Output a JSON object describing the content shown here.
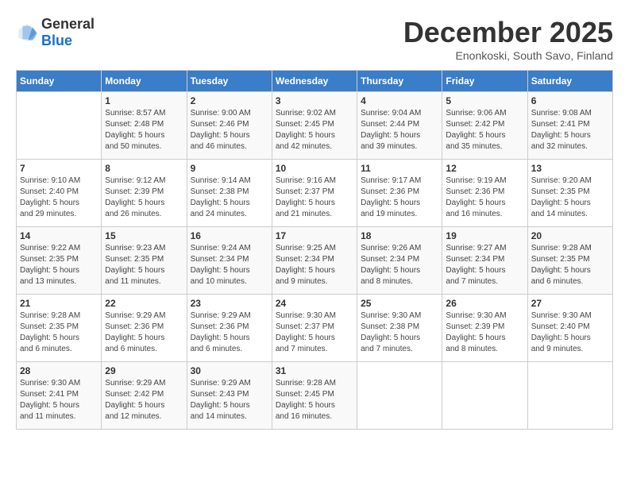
{
  "header": {
    "logo_general": "General",
    "logo_blue": "Blue",
    "month_title": "December 2025",
    "subtitle": "Enonkoski, South Savo, Finland"
  },
  "calendar": {
    "days_of_week": [
      "Sunday",
      "Monday",
      "Tuesday",
      "Wednesday",
      "Thursday",
      "Friday",
      "Saturday"
    ],
    "weeks": [
      [
        {
          "day": "",
          "info": ""
        },
        {
          "day": "1",
          "info": "Sunrise: 8:57 AM\nSunset: 2:48 PM\nDaylight: 5 hours\nand 50 minutes."
        },
        {
          "day": "2",
          "info": "Sunrise: 9:00 AM\nSunset: 2:46 PM\nDaylight: 5 hours\nand 46 minutes."
        },
        {
          "day": "3",
          "info": "Sunrise: 9:02 AM\nSunset: 2:45 PM\nDaylight: 5 hours\nand 42 minutes."
        },
        {
          "day": "4",
          "info": "Sunrise: 9:04 AM\nSunset: 2:44 PM\nDaylight: 5 hours\nand 39 minutes."
        },
        {
          "day": "5",
          "info": "Sunrise: 9:06 AM\nSunset: 2:42 PM\nDaylight: 5 hours\nand 35 minutes."
        },
        {
          "day": "6",
          "info": "Sunrise: 9:08 AM\nSunset: 2:41 PM\nDaylight: 5 hours\nand 32 minutes."
        }
      ],
      [
        {
          "day": "7",
          "info": "Sunrise: 9:10 AM\nSunset: 2:40 PM\nDaylight: 5 hours\nand 29 minutes."
        },
        {
          "day": "8",
          "info": "Sunrise: 9:12 AM\nSunset: 2:39 PM\nDaylight: 5 hours\nand 26 minutes."
        },
        {
          "day": "9",
          "info": "Sunrise: 9:14 AM\nSunset: 2:38 PM\nDaylight: 5 hours\nand 24 minutes."
        },
        {
          "day": "10",
          "info": "Sunrise: 9:16 AM\nSunset: 2:37 PM\nDaylight: 5 hours\nand 21 minutes."
        },
        {
          "day": "11",
          "info": "Sunrise: 9:17 AM\nSunset: 2:36 PM\nDaylight: 5 hours\nand 19 minutes."
        },
        {
          "day": "12",
          "info": "Sunrise: 9:19 AM\nSunset: 2:36 PM\nDaylight: 5 hours\nand 16 minutes."
        },
        {
          "day": "13",
          "info": "Sunrise: 9:20 AM\nSunset: 2:35 PM\nDaylight: 5 hours\nand 14 minutes."
        }
      ],
      [
        {
          "day": "14",
          "info": "Sunrise: 9:22 AM\nSunset: 2:35 PM\nDaylight: 5 hours\nand 13 minutes."
        },
        {
          "day": "15",
          "info": "Sunrise: 9:23 AM\nSunset: 2:35 PM\nDaylight: 5 hours\nand 11 minutes."
        },
        {
          "day": "16",
          "info": "Sunrise: 9:24 AM\nSunset: 2:34 PM\nDaylight: 5 hours\nand 10 minutes."
        },
        {
          "day": "17",
          "info": "Sunrise: 9:25 AM\nSunset: 2:34 PM\nDaylight: 5 hours\nand 9 minutes."
        },
        {
          "day": "18",
          "info": "Sunrise: 9:26 AM\nSunset: 2:34 PM\nDaylight: 5 hours\nand 8 minutes."
        },
        {
          "day": "19",
          "info": "Sunrise: 9:27 AM\nSunset: 2:34 PM\nDaylight: 5 hours\nand 7 minutes."
        },
        {
          "day": "20",
          "info": "Sunrise: 9:28 AM\nSunset: 2:35 PM\nDaylight: 5 hours\nand 6 minutes."
        }
      ],
      [
        {
          "day": "21",
          "info": "Sunrise: 9:28 AM\nSunset: 2:35 PM\nDaylight: 5 hours\nand 6 minutes."
        },
        {
          "day": "22",
          "info": "Sunrise: 9:29 AM\nSunset: 2:36 PM\nDaylight: 5 hours\nand 6 minutes."
        },
        {
          "day": "23",
          "info": "Sunrise: 9:29 AM\nSunset: 2:36 PM\nDaylight: 5 hours\nand 6 minutes."
        },
        {
          "day": "24",
          "info": "Sunrise: 9:30 AM\nSunset: 2:37 PM\nDaylight: 5 hours\nand 7 minutes."
        },
        {
          "day": "25",
          "info": "Sunrise: 9:30 AM\nSunset: 2:38 PM\nDaylight: 5 hours\nand 7 minutes."
        },
        {
          "day": "26",
          "info": "Sunrise: 9:30 AM\nSunset: 2:39 PM\nDaylight: 5 hours\nand 8 minutes."
        },
        {
          "day": "27",
          "info": "Sunrise: 9:30 AM\nSunset: 2:40 PM\nDaylight: 5 hours\nand 9 minutes."
        }
      ],
      [
        {
          "day": "28",
          "info": "Sunrise: 9:30 AM\nSunset: 2:41 PM\nDaylight: 5 hours\nand 11 minutes."
        },
        {
          "day": "29",
          "info": "Sunrise: 9:29 AM\nSunset: 2:42 PM\nDaylight: 5 hours\nand 12 minutes."
        },
        {
          "day": "30",
          "info": "Sunrise: 9:29 AM\nSunset: 2:43 PM\nDaylight: 5 hours\nand 14 minutes."
        },
        {
          "day": "31",
          "info": "Sunrise: 9:28 AM\nSunset: 2:45 PM\nDaylight: 5 hours\nand 16 minutes."
        },
        {
          "day": "",
          "info": ""
        },
        {
          "day": "",
          "info": ""
        },
        {
          "day": "",
          "info": ""
        }
      ]
    ]
  }
}
